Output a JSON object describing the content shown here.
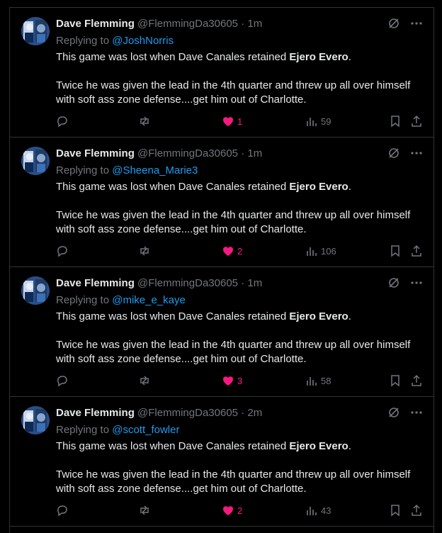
{
  "colors": {
    "background": "#000000",
    "text": "#e7e9ea",
    "muted": "#71767b",
    "link": "#1d9bf0",
    "like": "#f91880"
  },
  "icons": {
    "grok": "grok-icon",
    "more": "more-icon",
    "reply": "reply-icon",
    "repost": "repost-icon",
    "like": "heart-icon",
    "views": "views-icon",
    "bookmark": "bookmark-icon",
    "share": "share-icon"
  },
  "tweets": [
    {
      "name": "Dave Flemming",
      "handle": "@FlemmingDa30605",
      "separator": "·",
      "time": "1m",
      "replying_prefix": "Replying to",
      "replying_to": "@JoshNorris",
      "text_line1_pre": "This game was lost when Dave Canales retained ",
      "text_line1_bold": "Ejero Evero",
      "text_line1_post": ".",
      "text_para2": "Twice he was given the lead in the 4th quarter and threw up all over himself with soft ass zone defense....get him out of Charlotte.",
      "likes": "1",
      "views": "59"
    },
    {
      "name": "Dave Flemming",
      "handle": "@FlemmingDa30605",
      "separator": "·",
      "time": "1m",
      "replying_prefix": "Replying to",
      "replying_to": "@Sheena_Marie3",
      "text_line1_pre": "This game was lost when Dave Canales retained ",
      "text_line1_bold": "Ejero Evero",
      "text_line1_post": ".",
      "text_para2": "Twice he was given the lead in the 4th quarter and threw up all over himself with soft ass zone defense....get him out of Charlotte.",
      "likes": "2",
      "views": "106"
    },
    {
      "name": "Dave Flemming",
      "handle": "@FlemmingDa30605",
      "separator": "·",
      "time": "1m",
      "replying_prefix": "Replying to",
      "replying_to": "@mike_e_kaye",
      "text_line1_pre": "This game was lost when Dave Canales retained ",
      "text_line1_bold": "Ejero Evero",
      "text_line1_post": ".",
      "text_para2": "Twice he was given the lead in the 4th quarter and threw up all over himself with soft ass zone defense....get him out of Charlotte.",
      "likes": "3",
      "views": "58"
    },
    {
      "name": "Dave Flemming",
      "handle": "@FlemmingDa30605",
      "separator": "·",
      "time": "2m",
      "replying_prefix": "Replying to",
      "replying_to": "@scott_fowler",
      "text_line1_pre": "This game was lost when Dave Canales retained ",
      "text_line1_bold": "Ejero Evero",
      "text_line1_post": ".",
      "text_para2": "Twice he was given the lead in the 4th quarter and threw up all over himself with soft ass zone defense....get him out of Charlotte.",
      "likes": "2",
      "views": "43"
    }
  ]
}
